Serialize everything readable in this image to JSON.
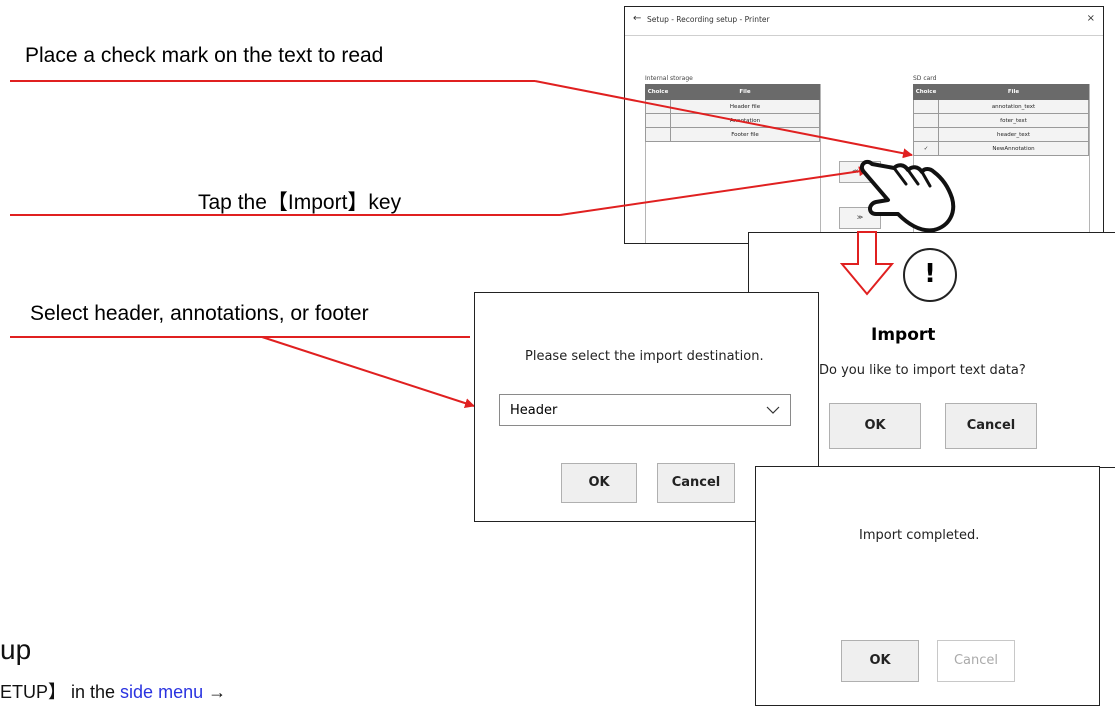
{
  "annotations": {
    "check": "Place a check mark on the text to read",
    "import": "Tap the【Import】key",
    "select": "Select header, annotations, or footer"
  },
  "window": {
    "back_icon": "←",
    "title": "Setup - Recording setup - Printer",
    "close_icon": "×",
    "internal_label": "Internal storage",
    "sd_label": "SD card",
    "columns": {
      "choice": "Choice",
      "file": "File"
    },
    "internal_files": [
      {
        "check": "",
        "name": "Header file"
      },
      {
        "check": "",
        "name": "Annotation"
      },
      {
        "check": "",
        "name": "Footer file"
      }
    ],
    "sd_files": [
      {
        "check": "",
        "name": "annotation_text"
      },
      {
        "check": "",
        "name": "foter_text"
      },
      {
        "check": "",
        "name": "header_text"
      },
      {
        "check": "✓",
        "name": "NewAnnotation"
      }
    ],
    "import_btn": "≪ Im",
    "export_btn": "≫"
  },
  "import_dialog": {
    "title": "Import",
    "message": "Do you like to import text data?",
    "ok": "OK",
    "cancel": "Cancel"
  },
  "destination_dialog": {
    "message": "Please select the import destination.",
    "selected": "Header",
    "ok": "OK",
    "cancel": "Cancel"
  },
  "completed_dialog": {
    "message": "Import completed.",
    "ok": "OK",
    "cancel": "Cancel"
  },
  "fragments": {
    "heading": "up",
    "line_pre": "ETUP】 in the ",
    "line_link": "side menu",
    "line_post": " →"
  },
  "colors": {
    "annotation_red": "#e02020",
    "link_blue": "#2a33e0",
    "header_gray": "#6a6a6a"
  }
}
